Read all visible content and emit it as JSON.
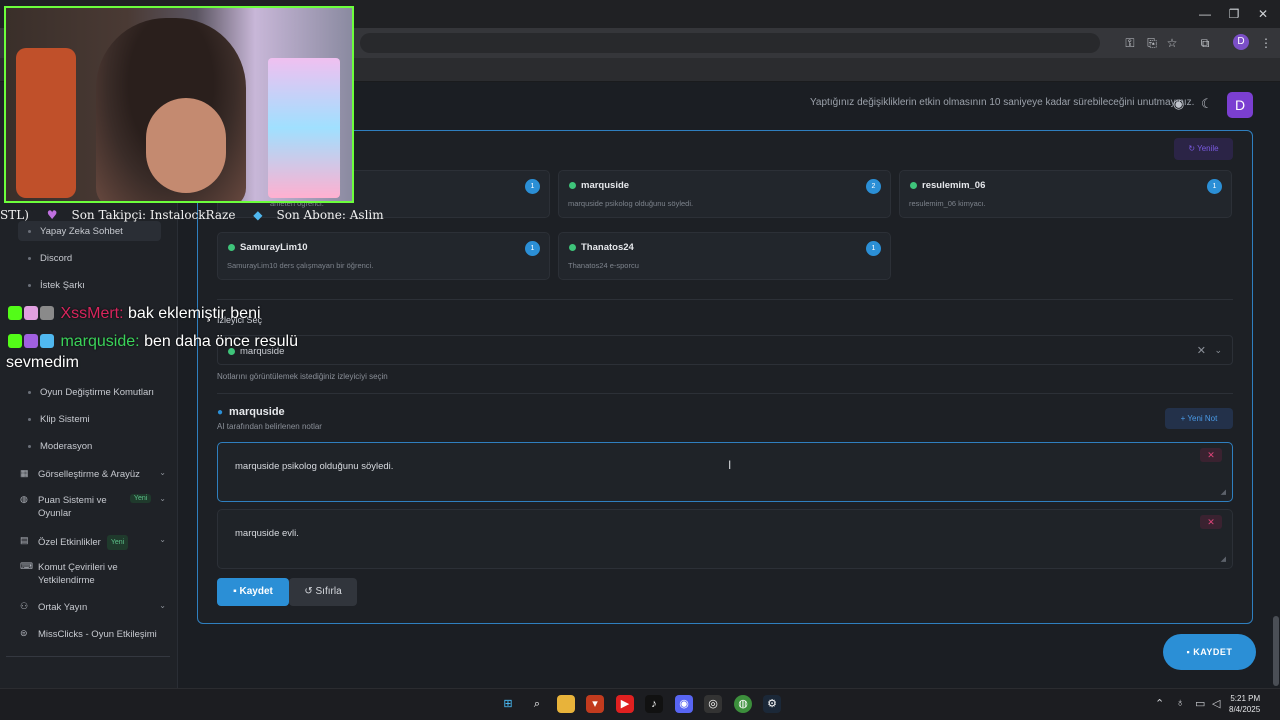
{
  "window": {
    "minimize": "—",
    "restore": "❐",
    "close": "✕"
  },
  "toolbar": {
    "key_icon": "key-icon",
    "install_icon": "install-icon",
    "star_icon": "star-icon",
    "extensions_icon": "puzzle-icon",
    "profile_letter": "D",
    "menu_icon": "⋮"
  },
  "header": {
    "notice": "Yaptığınız değişikliklerin etkin olmasının 10 saniyeye kadar sürebileceğini unutmayınız.",
    "avatar_letter": "D"
  },
  "sidebar": {
    "active_item": "Yapay Zeka Sohbet",
    "items": [
      "Yapay Zeka Sohbet",
      "Discord",
      "İstek Şarkı",
      "Oyun Değiştirme Komutları",
      "Klip Sistemi",
      "Moderasyon"
    ],
    "groups": [
      {
        "label": "Görselleştirme & Arayüz",
        "badge": ""
      },
      {
        "label": "Puan Sistemi ve Oyunlar",
        "badge": "Yeni"
      },
      {
        "label": "Özel Etkinlikler",
        "badge": "Yeni"
      },
      {
        "label": "Komut Çevirileri ve Yetkilendirme",
        "badge": ""
      },
      {
        "label": "Ortak Yayın",
        "badge": ""
      },
      {
        "label": "MissClicks - Oyun Etkileşimi",
        "badge": ""
      }
    ]
  },
  "main": {
    "refresh_label": "Yenile",
    "viewers": [
      {
        "name": "",
        "desc": "ameten öğrenci.",
        "count": "1"
      },
      {
        "name": "marquside",
        "desc": "marquside psikolog olduğunu söyledi.",
        "count": "2"
      },
      {
        "name": "resulemim_06",
        "desc": "resulemim_06 kimyacı.",
        "count": "1"
      },
      {
        "name": "SamurayLim10",
        "desc": "SamurayLim10 ders çalışmayan bir öğrenci.",
        "count": "1"
      },
      {
        "name": "Thanatos24",
        "desc": "Thanatos24 e-sporcu",
        "count": "1"
      }
    ],
    "select_label": "İzleyici Seç",
    "select_value": "marquside",
    "select_helper": "Notlarını görüntülemek istediğiniz izleyiciyi seçin",
    "user_title": "marquside",
    "user_sub": "AI tarafından belirlenen notlar",
    "new_note_label": "Yeni Not",
    "notes": [
      "marquside psikolog olduğunu söyledi.",
      "marquside evli."
    ],
    "save_label": "Kaydet",
    "reset_label": "Sıfırla",
    "fab_label": "KAYDET"
  },
  "stream": {
    "bar_left": "STL)",
    "last_follower": "Son Takipçi: InstalockRaze",
    "last_sub": "Son Abone: Aslim",
    "chat": [
      {
        "user": "XssMert:",
        "message": "bak eklemiştir beni"
      },
      {
        "user": "marquside:",
        "message": "ben daha önce resulü"
      },
      {
        "user": "",
        "message": "sevmedim"
      }
    ]
  },
  "taskbar": {
    "time": "5:21 PM",
    "date": "8/4/2025"
  }
}
